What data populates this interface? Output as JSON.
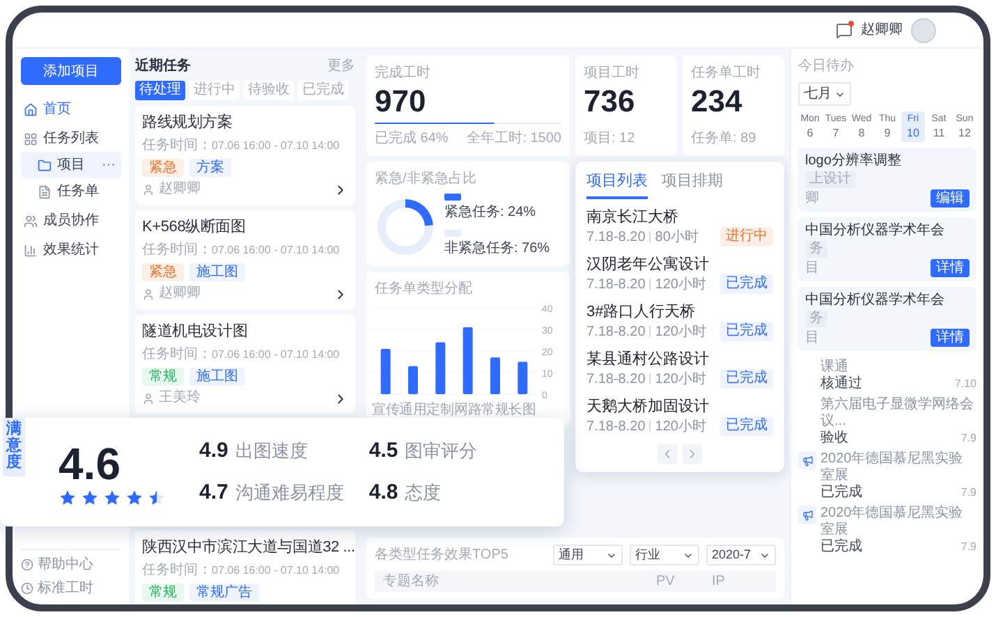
{
  "header": {
    "user": "赵卿卿",
    "has_message": true
  },
  "sidebar": {
    "add_button": "添加项目",
    "items": [
      {
        "label": "首页",
        "selected": true
      },
      {
        "label": "任务列表",
        "selected": false,
        "children": [
          {
            "label": "项目",
            "selected": true,
            "more": "···"
          },
          {
            "label": "任务单",
            "selected": false
          }
        ]
      },
      {
        "label": "成员协作",
        "selected": false
      },
      {
        "label": "效果统计",
        "selected": false
      }
    ],
    "footer": [
      {
        "label": "帮助中心"
      },
      {
        "label": "标准工时"
      }
    ]
  },
  "tasks": {
    "title": "近期任务",
    "more": "更多",
    "tabs": [
      {
        "label": "待处理",
        "selected": true
      },
      {
        "label": "进行中",
        "selected": false
      },
      {
        "label": "待验收",
        "selected": false
      },
      {
        "label": "已完成",
        "selected": false
      }
    ],
    "cards": [
      {
        "title": "路线规划方案",
        "time_label": "任务时间：",
        "time": "07.06 16:00 - 07.10 14:00",
        "tags": [
          {
            "label": "紧急",
            "kind": "urgent"
          },
          {
            "label": "方案",
            "kind": "type"
          }
        ],
        "person": "赵卿卿"
      },
      {
        "title": "K+568纵断面图",
        "time_label": "任务时间：",
        "time": "07.06 16:00 - 07.10 14:00",
        "tags": [
          {
            "label": "紧急",
            "kind": "urgent"
          },
          {
            "label": "施工图",
            "kind": "type"
          }
        ],
        "person": "赵卿卿"
      },
      {
        "title": "隧道机电设计图",
        "time_label": "任务时间：",
        "time": "07.06 16:00 - 07.10 14:00",
        "tags": [
          {
            "label": "常规",
            "kind": "normal"
          },
          {
            "label": "施工图",
            "kind": "type"
          }
        ],
        "person": "王美玲"
      },
      {
        "title": "陕西汉中市滨江大道与国道32 ...",
        "time_label": "任务时间：",
        "time": "07.06 16:00 - 07.10 14:00",
        "tags": [
          {
            "label": "常规",
            "kind": "normal"
          },
          {
            "label": "常规广告",
            "kind": "type"
          }
        ]
      }
    ]
  },
  "stats": [
    {
      "label": "完成工时",
      "value": "970",
      "level": 0.64,
      "note_left": "已完成 64%",
      "note_right": "全年工时: 1500"
    },
    {
      "label": "项目工时",
      "value": "736",
      "note_left": "项目: 12"
    },
    {
      "label": "任务单工时",
      "value": "234",
      "note_left": "任务单: 89"
    }
  ],
  "urgency": {
    "title": "紧急/非紧急占比",
    "legend": [
      {
        "color": "#2f6bff"
      },
      {
        "color": "#e6eefc"
      }
    ],
    "chart_data": {
      "type": "donut",
      "categories": [
        "紧急任务",
        "非紧急任务"
      ],
      "values": [
        24,
        76
      ],
      "value_labels": [
        ": 24%",
        ": 76%"
      ]
    }
  },
  "distribution": {
    "title": "任务单类型分配",
    "chart_data": {
      "type": "bar",
      "categories": [
        "宣传",
        "通用",
        "定制",
        "网路",
        "常规",
        "长图"
      ],
      "values": [
        21,
        13,
        24,
        31,
        17,
        15
      ],
      "ylim": [
        0,
        40
      ],
      "yticks": [
        0,
        10,
        20,
        30,
        40
      ],
      "grid": true
    }
  },
  "projects": {
    "tabs": [
      {
        "label": "项目列表",
        "selected": true
      },
      {
        "label": "项目排期",
        "selected": false
      }
    ],
    "items": [
      {
        "name": "南京长江大桥",
        "dates": "7.18-8.20",
        "hours": "80小时",
        "status": "进行中",
        "kind": "ongoing"
      },
      {
        "name": "汉阴老年公寓设计",
        "dates": "7.18-8.20",
        "hours": "120小时",
        "status": "已完成",
        "kind": "done"
      },
      {
        "name": "3#路口人行天桥",
        "dates": "7.18-8.20",
        "hours": "120小时",
        "status": "已完成",
        "kind": "done"
      },
      {
        "name": "某县通村公路设计",
        "dates": "7.18-8.20",
        "hours": "120小时",
        "status": "已完成",
        "kind": "done"
      },
      {
        "name": "天鹅大桥加固设计",
        "dates": "7.18-8.20",
        "hours": "120小时",
        "status": "已完成",
        "kind": "done"
      }
    ]
  },
  "top5": {
    "title": "各类型任务效果TOP5",
    "filters": [
      "通用",
      "行业",
      "2020-7"
    ],
    "columns": [
      "专题名称",
      "PV",
      "IP"
    ]
  },
  "today": {
    "title": "今日待办",
    "month": "七月",
    "days": [
      {
        "dow": "Mon",
        "date": "6",
        "selected": false
      },
      {
        "dow": "Tues",
        "date": "7",
        "selected": false
      },
      {
        "dow": "Wed",
        "date": "8",
        "selected": false
      },
      {
        "dow": "Thu",
        "date": "9",
        "selected": false
      },
      {
        "dow": "Fri",
        "date": "10",
        "selected": true
      },
      {
        "dow": "Sat",
        "date": "11",
        "selected": false
      },
      {
        "dow": "Sun",
        "date": "12",
        "selected": false
      }
    ],
    "todos": [
      {
        "title": "logo分辨率调整",
        "tag": "上设计",
        "person": "卿",
        "button": "编辑"
      },
      {
        "title": "中国分析仪器学术年会",
        "tag": "务",
        "person": "目",
        "button": "详情"
      },
      {
        "title": "中国分析仪器学术年会",
        "tag": "务",
        "person": "目",
        "button": "详情"
      }
    ],
    "notices": [
      {
        "title": "课通",
        "status": "核通过",
        "date": "7.10",
        "icon": false
      },
      {
        "title": "第六届电子显微学网络会议...",
        "status": "验收",
        "date": "7.9",
        "icon": false
      },
      {
        "title": "2020年德国慕尼黑实验室展",
        "status": "已完成",
        "date": "7.9",
        "icon": true
      },
      {
        "title": "2020年德国慕尼黑实验室展",
        "status": "已完成",
        "date": "7.9",
        "icon": true
      }
    ]
  },
  "satisfaction": {
    "label": "满意度",
    "score": "4.6",
    "stars": 4.5,
    "metrics": [
      {
        "score": "4.9",
        "label": "出图速度"
      },
      {
        "score": "4.5",
        "label": "图审评分"
      },
      {
        "score": "4.7",
        "label": "沟通难易程度"
      },
      {
        "score": "4.8",
        "label": "态度"
      }
    ]
  }
}
